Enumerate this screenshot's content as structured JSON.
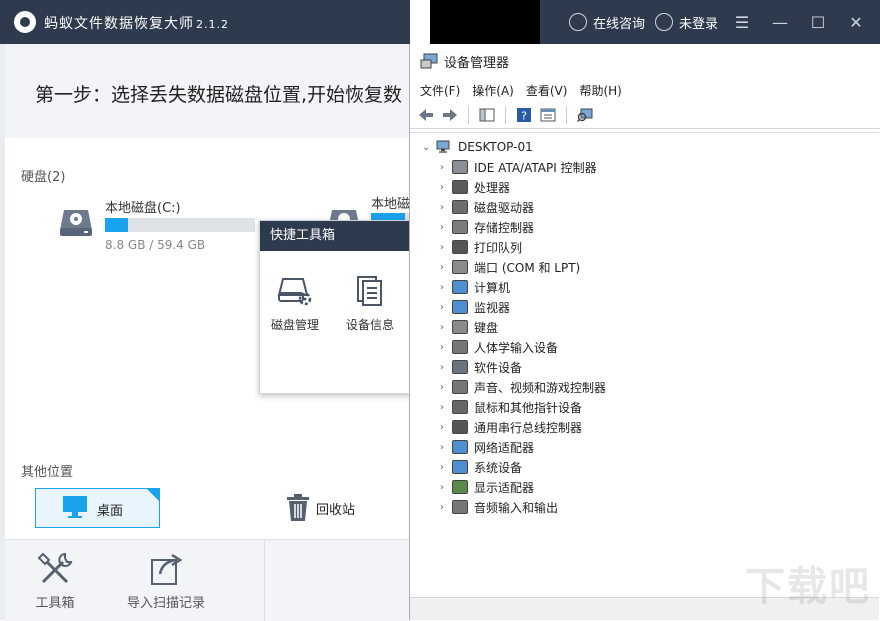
{
  "app": {
    "title": "蚂蚁文件数据恢复大师",
    "version": "2.1.2",
    "consult_label": "在线咨询",
    "login_label": "未登录",
    "step_text": "第一步：选择丢失数据磁盘位置,开始恢复数",
    "harddisk_label": "硬盘(2)",
    "disks": [
      {
        "name": "本地磁盘(C:)",
        "size": "8.8 GB / 59.4 GB",
        "usage_fraction": 0.15
      },
      {
        "name": "本地磁",
        "size": "",
        "usage_fraction": 0.9
      }
    ],
    "other_label": "其他位置",
    "desktop_label": "桌面",
    "recycle_label": "回收站",
    "bottom_tools": [
      {
        "label": "工具箱"
      },
      {
        "label": "导入扫描记录"
      }
    ],
    "toolbox": {
      "title": "快捷工具箱",
      "tools": [
        {
          "label": "磁盘管理"
        },
        {
          "label": "设备信息"
        }
      ]
    }
  },
  "device_manager": {
    "title": "设备管理器",
    "menu": [
      "文件(F)",
      "操作(A)",
      "查看(V)",
      "帮助(H)"
    ],
    "root": "DESKTOP-01",
    "devices": [
      {
        "label": "IDE ATA/ATAPI 控制器",
        "icon": "ide-icon"
      },
      {
        "label": "处理器",
        "icon": "cpu-icon"
      },
      {
        "label": "磁盘驱动器",
        "icon": "disk-drive-icon"
      },
      {
        "label": "存储控制器",
        "icon": "storage-icon"
      },
      {
        "label": "打印队列",
        "icon": "printer-icon"
      },
      {
        "label": "端口 (COM 和 LPT)",
        "icon": "port-icon"
      },
      {
        "label": "计算机",
        "icon": "computer-icon"
      },
      {
        "label": "监视器",
        "icon": "monitor-icon"
      },
      {
        "label": "键盘",
        "icon": "keyboard-icon"
      },
      {
        "label": "人体学输入设备",
        "icon": "hid-icon"
      },
      {
        "label": "软件设备",
        "icon": "software-device-icon"
      },
      {
        "label": "声音、视频和游戏控制器",
        "icon": "sound-icon"
      },
      {
        "label": "鼠标和其他指针设备",
        "icon": "mouse-icon"
      },
      {
        "label": "通用串行总线控制器",
        "icon": "usb-icon"
      },
      {
        "label": "网络适配器",
        "icon": "network-icon"
      },
      {
        "label": "系统设备",
        "icon": "system-icon"
      },
      {
        "label": "显示适配器",
        "icon": "display-adapter-icon"
      },
      {
        "label": "音频输入和输出",
        "icon": "audio-io-icon"
      }
    ],
    "watermark": "下载吧"
  },
  "colors": {
    "titlebar": "#2e3b4e",
    "accent": "#19a3ec"
  }
}
